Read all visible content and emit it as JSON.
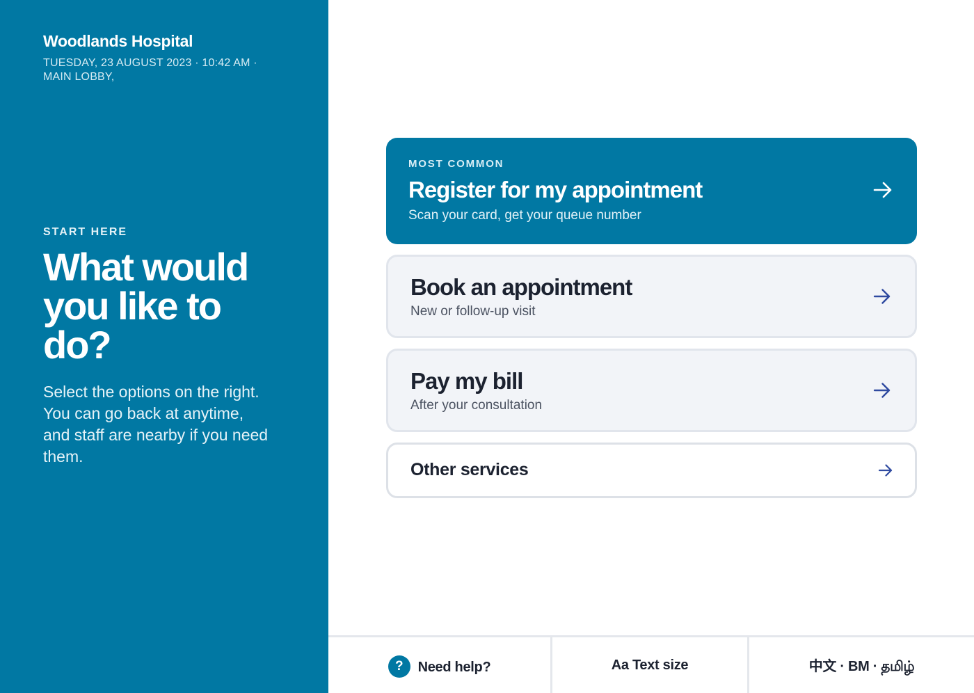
{
  "sidebar": {
    "hospital_name": "Woodlands Hospital",
    "datetime": "TUESDAY, 23 AUGUST 2023 · 10:42 AM · MAIN LOBBY,",
    "eyebrow": "START HERE",
    "headline": "What would you like to do?",
    "description": "Select the options on the right. You can go back at anytime, and staff are nearby if you need them."
  },
  "options": [
    {
      "tag": "MOST COMMON",
      "title": "Register for my appointment",
      "subtitle": "Scan your card, get your queue number",
      "icon": "arrow-right-icon"
    },
    {
      "title": "Book an appointment",
      "subtitle": "New or follow-up visit",
      "icon": "arrow-right-icon"
    },
    {
      "title": "Pay my bill",
      "subtitle": "After your consultation",
      "icon": "arrow-right-icon"
    },
    {
      "title": "Other services",
      "icon": "arrow-right-icon"
    }
  ],
  "bottom_bar": {
    "help_icon": "?",
    "help_label": "Need help?",
    "text_size_label": "Aa Text size",
    "language_label": "中文 · BM · தமிழ்"
  },
  "colors": {
    "primary": "#0178a3",
    "card_bg": "#f2f4f8",
    "border": "#e1e5ec",
    "arrow": "#2f4aa0"
  }
}
